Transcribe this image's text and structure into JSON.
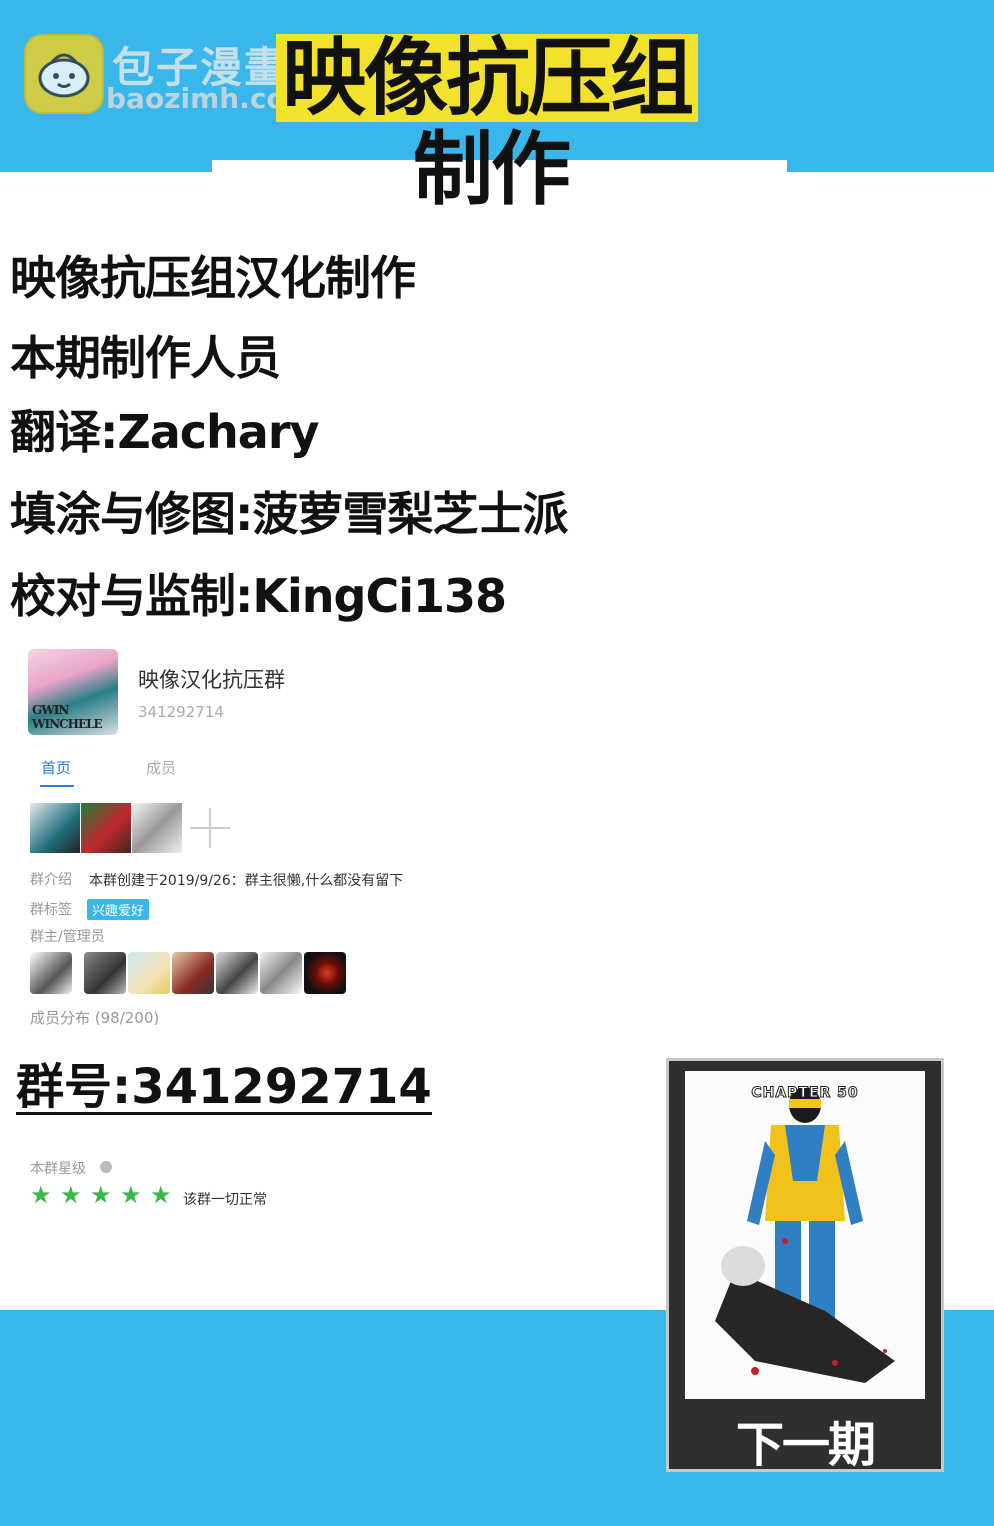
{
  "watermark": {
    "site_name": "包子漫畫",
    "site_url": "baozimh.com",
    "logo_icon": "bun-icon"
  },
  "header": {
    "title_line1": "映像抗压组",
    "title_line2": "制作"
  },
  "credits": [
    "映像抗压组汉化制作",
    "本期制作人员",
    "翻译:Zachary",
    "填涂与修图:菠萝雪梨芝士派",
    "校对与监制:KingCi138"
  ],
  "group": {
    "avatar_caption": "GWIN WINCHELE",
    "name": "映像汉化抗压群",
    "id": "341292714",
    "tabs": {
      "home": "首页",
      "members": "成员"
    },
    "intro_label": "群介绍",
    "intro_text": "本群创建于2019/9/26：群主很懒,什么都没有留下",
    "tags_label": "群标签",
    "tag": "兴趣爱好",
    "admins_label": "群主/管理员",
    "distribution": "成员分布 (98/200)"
  },
  "qq_number": "群号:341292714",
  "rank": {
    "label": "本群星级",
    "stars": 5,
    "status": "该群一切正常"
  },
  "next": {
    "cover_title": "CHAPTER 50",
    "label": "下一期"
  },
  "colors": {
    "band": "#39b7ea",
    "highlight": "#f2e22b",
    "tab_active": "#2b7de0",
    "star": "#3cb54a"
  }
}
